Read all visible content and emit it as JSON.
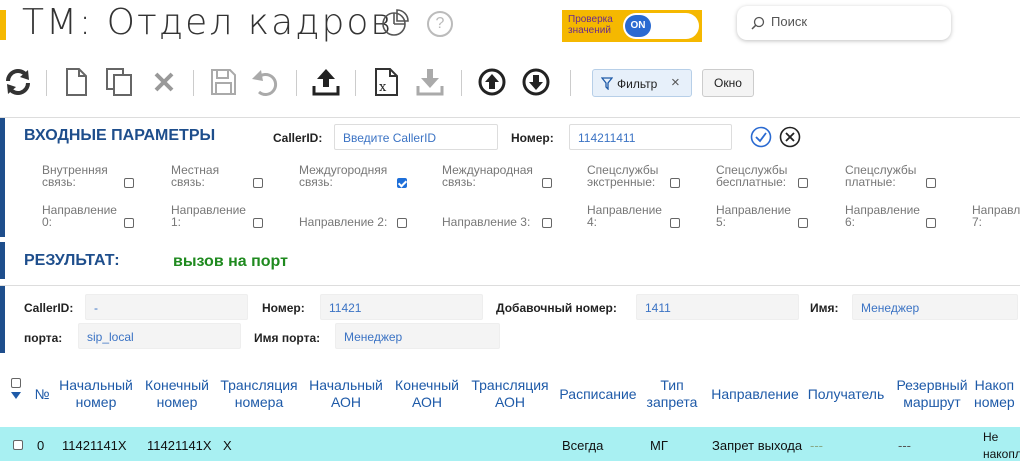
{
  "header": {
    "title": "ТМ: Отдел кадров",
    "help": "?",
    "check_label_line1": "Проверка",
    "check_label_line2": "значений",
    "toggle_label": "ON",
    "search_placeholder": "Поиск"
  },
  "toolbar": {
    "filter_label": "Фильтр",
    "filter_close": "×",
    "window_label": "Окно"
  },
  "input": {
    "title": "ВХОДНЫЕ ПАРАМЕТРЫ",
    "callerid_label": "CallerID:",
    "callerid_placeholder": "Введите CallerID",
    "number_label": "Номер:",
    "number_value": "114211411",
    "options_row1": [
      {
        "line1": "Внутренняя",
        "line2": "связь:",
        "checked": false
      },
      {
        "line1": "Местная",
        "line2": "связь:",
        "checked": false
      },
      {
        "line1": "Междугородняя",
        "line2": "связь:",
        "checked": true
      },
      {
        "line1": "Международная",
        "line2": "связь:",
        "checked": false
      },
      {
        "line1": "Спецслужбы",
        "line2": "экстренные:",
        "checked": false
      },
      {
        "line1": "Спецслужбы",
        "line2": "бесплатные:",
        "checked": false
      },
      {
        "line1": "Спецслужбы",
        "line2": "платные:",
        "checked": false
      }
    ],
    "options_row2": [
      {
        "line1": "Направление",
        "line2": "0:"
      },
      {
        "line1": "Направление",
        "line2": "1:"
      },
      {
        "line1": "",
        "line2": "Направление 2:"
      },
      {
        "line1": "",
        "line2": "Направление 3:"
      },
      {
        "line1": "Направление",
        "line2": "4:"
      },
      {
        "line1": "Направление",
        "line2": "5:"
      },
      {
        "line1": "Направление",
        "line2": "6:"
      },
      {
        "line1": "Направл",
        "line2": "7:"
      }
    ]
  },
  "result": {
    "title": "РЕЗУЛЬТАТ:",
    "value": "вызов на порт"
  },
  "details": {
    "callerid_label": "CallerID:",
    "callerid_value": "-",
    "number_label": "Номер:",
    "number_value": "11421",
    "ext_label": "Добавочный номер:",
    "ext_value": "1411",
    "name_label": "Имя:",
    "name_value": "Менеджер",
    "port_label": "порта:",
    "port_value": "sip_local",
    "port_name_label": "Имя порта:",
    "port_name_value": "Менеджер"
  },
  "table": {
    "headers": [
      {
        "l1": "№",
        "l2": ""
      },
      {
        "l1": "Начальный",
        "l2": "номер"
      },
      {
        "l1": "Конечный",
        "l2": "номер"
      },
      {
        "l1": "Трансляция",
        "l2": "номера"
      },
      {
        "l1": "Начальный",
        "l2": "АОН"
      },
      {
        "l1": "Конечный",
        "l2": "АОН"
      },
      {
        "l1": "Трансляция",
        "l2": "АОН"
      },
      {
        "l1": "Расписание",
        "l2": ""
      },
      {
        "l1": "Тип",
        "l2": "запрета"
      },
      {
        "l1": "Направление",
        "l2": ""
      },
      {
        "l1": "Получатель",
        "l2": ""
      },
      {
        "l1": "Резервный",
        "l2": "маршрут"
      },
      {
        "l1": "Накоп",
        "l2": "номер"
      }
    ],
    "row": {
      "num": "0",
      "start_number": "11421141X",
      "end_number": "11421141X",
      "translation": "X",
      "schedule": "Всегда",
      "ban_type": "МГ",
      "direction": "Запрет выхода",
      "recipient": "---",
      "reserve": "---",
      "accum_l1": "Не",
      "accum_l2": "накопл"
    }
  },
  "colors": {
    "accent": "#f5b800",
    "brand_blue": "#1e4e8c",
    "result_green": "#1f8a1f",
    "row_highlight": "#a8f0f2"
  }
}
